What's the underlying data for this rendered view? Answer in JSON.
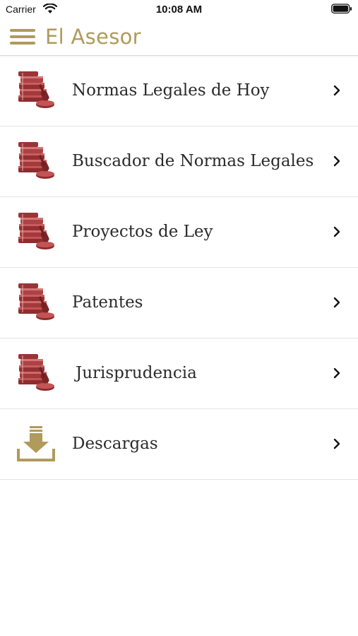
{
  "status_bar": {
    "carrier": "Carrier",
    "time": "10:08 AM"
  },
  "header": {
    "title": "El Asesor",
    "menu_icon": "hamburger-menu-icon"
  },
  "colors": {
    "accent_gold": "#b09a5c",
    "book_red": "#a8383a",
    "text": "#2b2b2b",
    "divider": "#e4e4e4"
  },
  "menu": {
    "items": [
      {
        "label": "Normas Legales de Hoy",
        "icon": "law-books-gavel-icon"
      },
      {
        "label": "Buscador de Normas Legales",
        "icon": "law-books-gavel-icon"
      },
      {
        "label": "Proyectos de Ley",
        "icon": "law-books-gavel-icon"
      },
      {
        "label": "Patentes",
        "icon": "law-books-gavel-icon"
      },
      {
        "label": "Jurisprudencia",
        "icon": "law-books-gavel-icon"
      },
      {
        "label": "Descargas",
        "icon": "download-tray-icon"
      }
    ]
  }
}
